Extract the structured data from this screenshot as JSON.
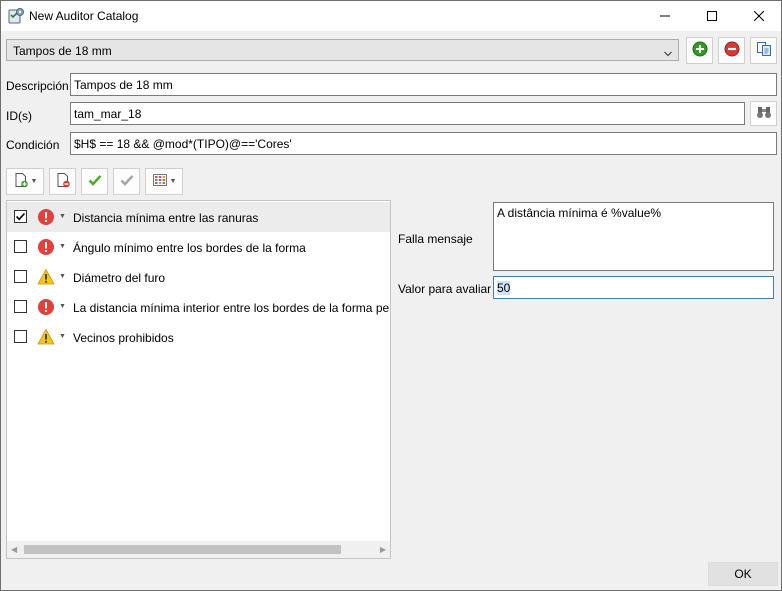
{
  "window": {
    "title": "New Auditor Catalog"
  },
  "catalog_select": {
    "value": "Tampos de 18 mm"
  },
  "form": {
    "descripcion_label": "Descripción",
    "descripcion_value": "Tampos de 18 mm",
    "ids_label": "ID(s)",
    "ids_value": "tam_mar_18",
    "condicion_label": "Condición",
    "condicion_value": "$H$ == 18 && @mod*(TIPO)@=='Cores'"
  },
  "rules": [
    {
      "label": "Distancia mínima entre las ranuras",
      "checked": true,
      "severity": "error"
    },
    {
      "label": "Ángulo mínimo entre los bordes de la forma",
      "checked": false,
      "severity": "error"
    },
    {
      "label": "Diámetro del furo",
      "checked": false,
      "severity": "warning"
    },
    {
      "label": "La distancia mínima interior entre los bordes de la forma per",
      "checked": false,
      "severity": "error"
    },
    {
      "label": "Vecinos prohibidos",
      "checked": false,
      "severity": "warning"
    }
  ],
  "detail": {
    "falla_label": "Falla mensaje",
    "falla_value": "A distância mínima é %value%",
    "valor_label": "Valor para avaliar",
    "valor_value": "50"
  },
  "footer": {
    "ok_label": "OK"
  },
  "icons": {
    "app": "checklist-gear-icon",
    "add": "plus-circle-icon",
    "remove": "minus-circle-icon",
    "copy": "copy-icon",
    "search": "binoculars-icon",
    "error": "exclamation-circle-icon",
    "warning": "warning-triangle-icon"
  },
  "colors": {
    "add_green": "#2e9e1f",
    "remove_red": "#d63a2f",
    "error_red": "#e0413a",
    "warning_yellow": "#f5c518",
    "selection_blue": "#cce4f7",
    "focus_border": "#3c7fb1"
  }
}
